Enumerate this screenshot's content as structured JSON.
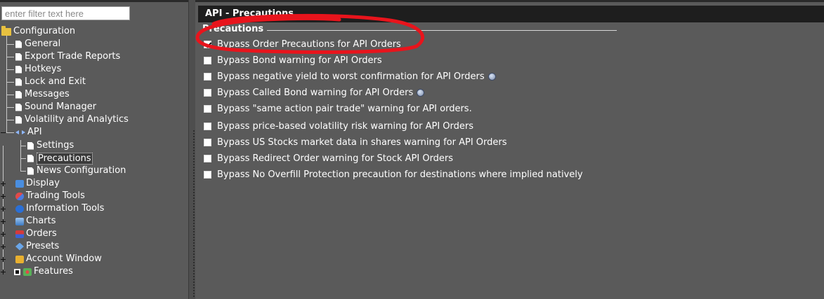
{
  "filter": {
    "placeholder": "enter filter text here"
  },
  "tree": {
    "root": "Configuration",
    "config_children": [
      "General",
      "Export Trade Reports",
      "Hotkeys",
      "Lock and Exit",
      "Messages",
      "Sound Manager",
      "Volatility and Analytics"
    ],
    "api": "API",
    "api_children": [
      "Settings",
      "Precautions",
      "News Configuration"
    ],
    "selected": "Precautions",
    "top_level": [
      "Display",
      "Trading Tools",
      "Information Tools",
      "Charts",
      "Orders",
      "Presets",
      "Account Window",
      "Features"
    ]
  },
  "panel": {
    "title": "API - Precautions",
    "group": "Precautions",
    "options": [
      {
        "label": "Bypass Order Precautions for API Orders",
        "checked": true,
        "help": false
      },
      {
        "label": "Bypass Bond warning for API Orders",
        "checked": false,
        "help": false
      },
      {
        "label": "Bypass negative yield to worst confirmation for API Orders",
        "checked": false,
        "help": true
      },
      {
        "label": "Bypass Called Bond warning for API Orders",
        "checked": false,
        "help": true
      },
      {
        "label": "Bypass \"same action pair trade\" warning for API orders.",
        "checked": false,
        "help": false
      },
      {
        "label": "Bypass price-based volatility risk warning for API Orders",
        "checked": false,
        "help": false
      },
      {
        "label": "Bypass US Stocks market data in shares warning for API Orders",
        "checked": false,
        "help": false
      },
      {
        "label": "Bypass Redirect Order warning for Stock API Orders",
        "checked": false,
        "help": false
      },
      {
        "label": "Bypass No Overfill Protection precaution for destinations where implied natively",
        "checked": false,
        "help": false
      }
    ]
  },
  "colors": {
    "panel_bg": "#5a5a5a",
    "header_bg": "#1e1e1e",
    "annotation": "#e8141c",
    "folder": "#e8c140"
  }
}
